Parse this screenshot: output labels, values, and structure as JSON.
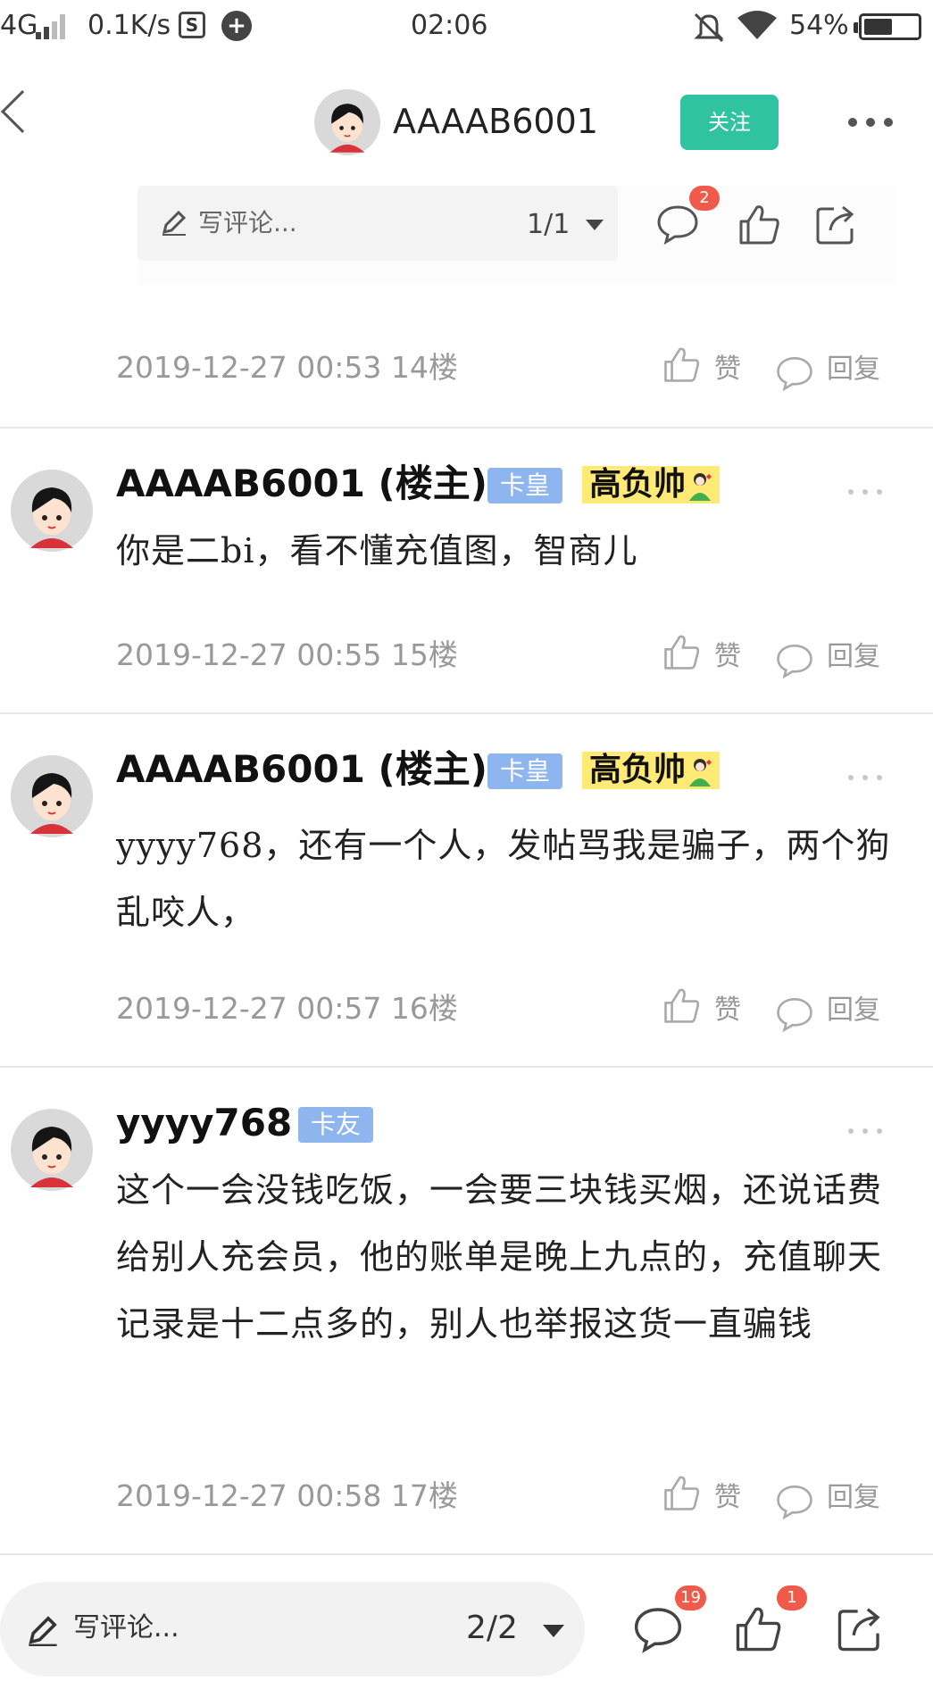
{
  "status_bar": {
    "network": "4G",
    "speed": "0.1K/s",
    "s_icon_label": "S",
    "time": "02:06",
    "battery": "54%",
    "battery_level": 0.54
  },
  "header": {
    "username": "AAAAB6001",
    "follow_label": "关注"
  },
  "float_bar": {
    "placeholder": "写评论...",
    "page": "1/1",
    "comment_badge": "2"
  },
  "posts": [
    {
      "meta": "2019-12-27 00:53  14楼",
      "like_label": "赞",
      "reply_label": "回复"
    },
    {
      "username": "AAAAB6001 (楼主)",
      "level": "卡皇",
      "medal": "高负帅",
      "content": "你是二bi，看不懂充值图，智商儿",
      "meta": "2019-12-27 00:55  15楼",
      "like_label": "赞",
      "reply_label": "回复"
    },
    {
      "username": "AAAAB6001 (楼主)",
      "level": "卡皇",
      "medal": "高负帅",
      "content": "yyyy768，还有一个人，发帖骂我是骗子，两个狗乱咬人，",
      "meta": "2019-12-27 00:57  16楼",
      "like_label": "赞",
      "reply_label": "回复"
    },
    {
      "username": "yyyy768",
      "level": "卡友",
      "content": "这个一会没钱吃饭，一会要三块钱买烟，还说话费给别人充会员，他的账单是晚上九点的，充值聊天记录是十二点多的，别人也举报这货一直骗钱",
      "meta": "2019-12-27 00:58  17楼",
      "like_label": "赞",
      "reply_label": "回复"
    }
  ],
  "bottom_bar": {
    "placeholder": "写评论...",
    "page": "2/2",
    "comment_badge": "19",
    "like_badge": "1"
  },
  "colors": {
    "follow": "#2fc39f",
    "level_tag": "#8fb5ee",
    "medal_bg": "#ffea76",
    "badge": "#f05a4a"
  },
  "icons": [
    "back-icon",
    "more-icon",
    "pencil-icon",
    "comment-icon",
    "like-icon",
    "share-icon",
    "wifi-icon",
    "mute-icon"
  ]
}
